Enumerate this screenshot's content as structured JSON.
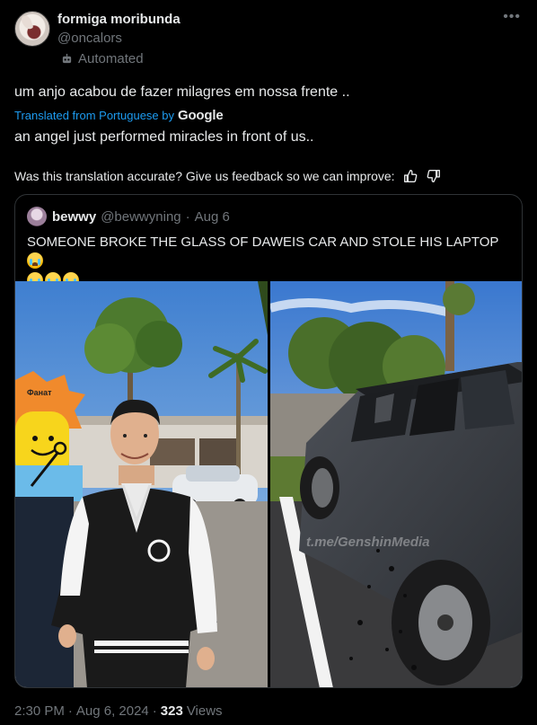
{
  "author": {
    "name": "formiga moribunda",
    "handle": "@oncalors",
    "badge": "Automated"
  },
  "post": {
    "original_text": "um anjo acabou de fazer milagres em nossa frente ..",
    "translated_label": "Translated from Portuguese by",
    "translator": "Google",
    "translated_text": "an angel just performed miracles in front of us..",
    "feedback_prompt": "Was this translation accurate? Give us feedback so we can improve:"
  },
  "quoted": {
    "name": "bewwy",
    "handle": "@bewwyning",
    "separator": "·",
    "date": "Aug 6",
    "text": "SOMEONE BROKE THE GLASS OF DAWEIS CAR AND STOLE HIS LAPTOP",
    "images": {
      "left_sign": "Фанат",
      "right_watermark": "t.me/GenshinMedia"
    }
  },
  "meta": {
    "time": "2:30 PM",
    "separator": "·",
    "date": "Aug 6, 2024",
    "separator2": "·",
    "views_count": "323",
    "views_label": "Views"
  },
  "icons": {
    "more": "more-icon",
    "bot": "robot-icon",
    "thumb_up": "thumbs-up-icon",
    "thumb_down": "thumbs-down-icon"
  },
  "colors": {
    "background": "#000000",
    "text": "#e7e9ea",
    "muted": "#71767b",
    "link": "#1d9bf0",
    "border": "#2f3336"
  }
}
